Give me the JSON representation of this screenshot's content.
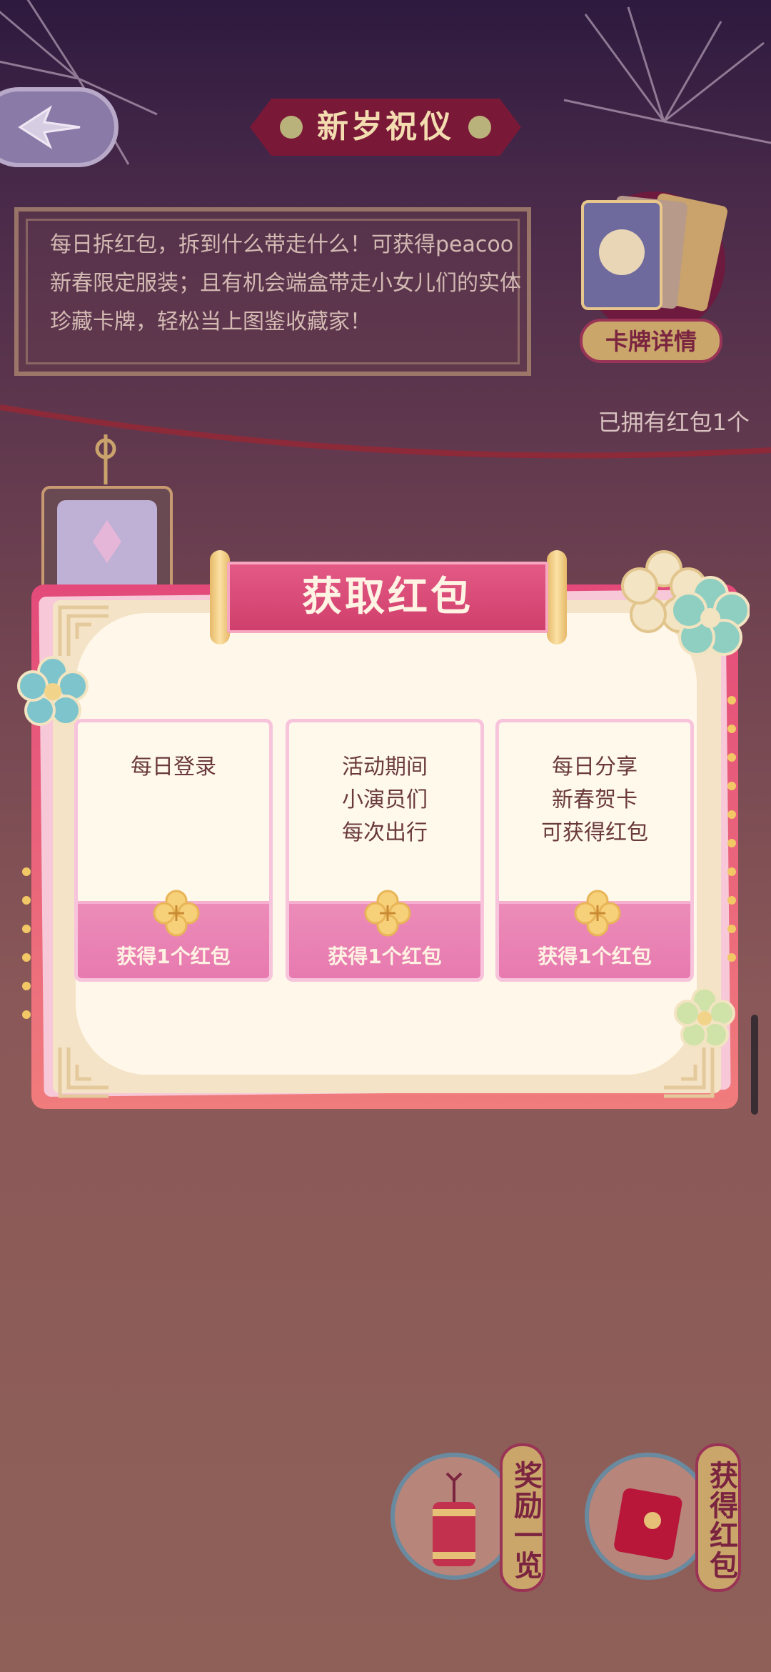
{
  "title": "新岁祝仪",
  "description": "每日拆红包，拆到什么带走什么！可获得peacoo新春限定服装；且有机会端盒带走小女儿们的实体珍藏卡牌，轻松当上图鉴收藏家！",
  "card_detail_label": "卡牌详情",
  "owned_text": "已拥有红包1个",
  "popup": {
    "title": "获取红包",
    "tasks": [
      {
        "text": "每日登录",
        "reward": "获得1个红包"
      },
      {
        "text": "活动期间\n小演员们\n每次出行",
        "reward": "获得1个红包"
      },
      {
        "text": "每日分享\n新春贺卡\n可获得红包",
        "reward": "获得1个红包"
      }
    ]
  },
  "bottom": {
    "rewards_label": "奖励一览",
    "get_label": "获得红包"
  },
  "icons": {
    "back": "back-arrow-icon",
    "rewards": "firecracker-icon",
    "get": "red-envelope-icon"
  },
  "colors": {
    "accent_pink": "#e34a7a",
    "gold": "#caa66b",
    "burgundy": "#9a3456"
  }
}
